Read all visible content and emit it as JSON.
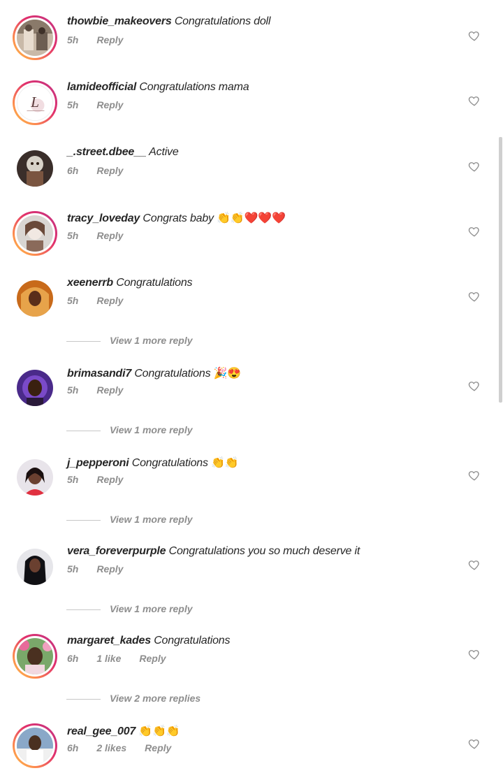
{
  "comments": [
    {
      "username": "thowbie_makeovers",
      "text": "Congratulations doll",
      "emoji": "",
      "time": "5h",
      "likes": "",
      "reply": "Reply",
      "story": true,
      "colors": [
        "#8a7a6a",
        "#c9b9a8",
        "#e8dccf"
      ]
    },
    {
      "username": "lamideofficial",
      "text": "Congratulations mama",
      "emoji": "",
      "time": "5h",
      "likes": "",
      "reply": "Reply",
      "story": true,
      "colors": [
        "#ffffff",
        "#e9d9dc",
        "#5a3a3a"
      ]
    },
    {
      "username": "_.street.dbee__",
      "text": "Active",
      "emoji": "",
      "time": "6h",
      "likes": "",
      "reply": "Reply",
      "story": false,
      "colors": [
        "#3a2e2a",
        "#d8d2c8",
        "#7a5540"
      ]
    },
    {
      "username": "tracy_loveday",
      "text": "Congrats baby",
      "emoji": "👏👏❤️❤️❤️",
      "time": "5h",
      "likes": "",
      "reply": "Reply",
      "story": true,
      "colors": [
        "#d9d6d2",
        "#f1e8e2",
        "#6a4a3a"
      ]
    },
    {
      "username": "xeenerrb",
      "text": "Congratulations",
      "emoji": "",
      "time": "5h",
      "likes": "",
      "reply": "Reply",
      "story": false,
      "colors": [
        "#c86a1a",
        "#e7a34a",
        "#5a2e1a"
      ]
    },
    {
      "username": "brimasandi7",
      "text": "Congratulations",
      "emoji": "🎉😍",
      "time": "5h",
      "likes": "",
      "reply": "Reply",
      "story": false,
      "colors": [
        "#4a2a8a",
        "#7a4ac8",
        "#3a2010"
      ]
    },
    {
      "username": "j_pepperoni",
      "text": "Congratulations",
      "emoji": "👏👏",
      "time": "5h",
      "likes": "",
      "reply": "Reply",
      "story": false,
      "colors": [
        "#e8e4ea",
        "#e03040",
        "#3a2010"
      ]
    },
    {
      "username": "vera_foreverpurple",
      "text": "Congratulations you so much deserve it",
      "emoji": "",
      "time": "5h",
      "likes": "",
      "reply": "Reply",
      "story": false,
      "colors": [
        "#e6e6ea",
        "#101014",
        "#6a4030"
      ]
    },
    {
      "username": "margaret_kades",
      "text": "Congratulations",
      "emoji": "",
      "time": "6h",
      "likes": "1 like",
      "reply": "Reply",
      "story": true,
      "colors": [
        "#7aa86a",
        "#f2d8e0",
        "#4a3020"
      ]
    },
    {
      "username": "real_gee_007",
      "text": "",
      "emoji": "👏👏👏",
      "time": "6h",
      "likes": "2 likes",
      "reply": "Reply",
      "story": true,
      "colors": [
        "#8aa8c8",
        "#f0f0f0",
        "#4a3020"
      ]
    }
  ],
  "view_more": {
    "r4": "View 1 more reply",
    "r5": "View 1 more reply",
    "r6": "View 1 more reply",
    "r7": "View 1 more reply",
    "r8": "View 2 more replies"
  },
  "avatar_text": {
    "lamide_logo": "L"
  },
  "theme": {
    "text": "#262626",
    "muted": "#8e8e8e",
    "story_gradient": [
      "#c13584",
      "#e1306c",
      "#fd8d4e",
      "#fcc34b"
    ]
  }
}
